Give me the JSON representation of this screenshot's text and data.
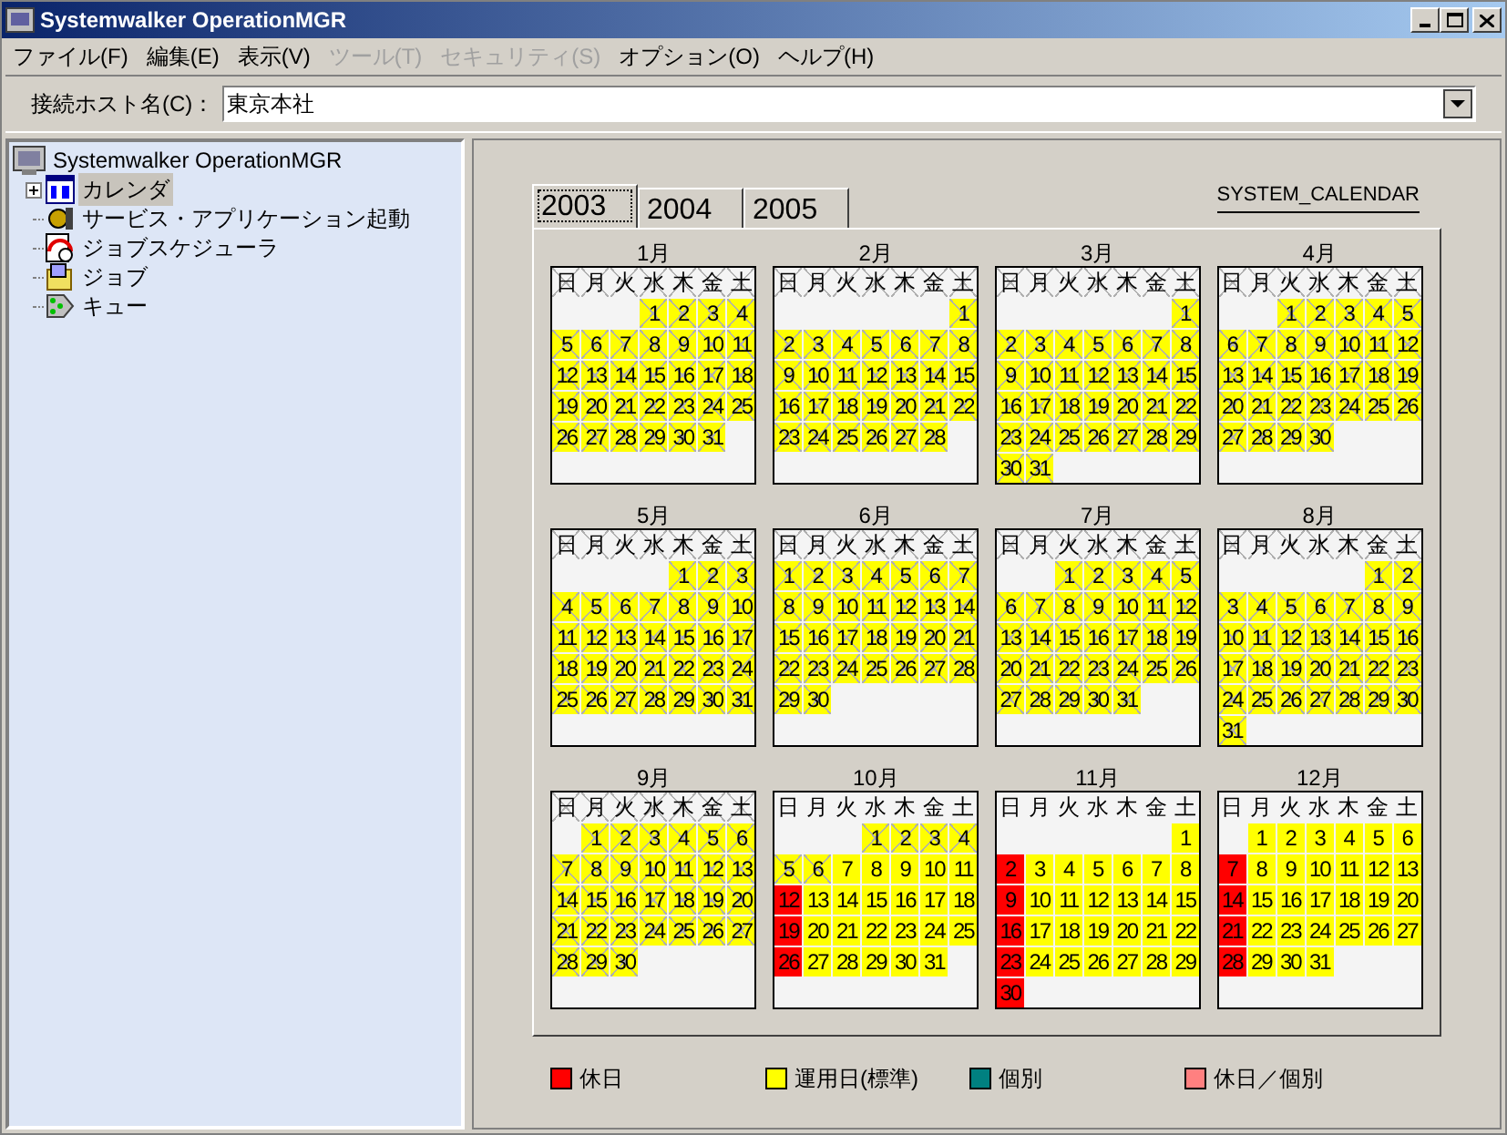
{
  "window": {
    "title": "Systemwalker OperationMGR"
  },
  "menu": [
    {
      "label": "ファイル(F)",
      "disabled": false
    },
    {
      "label": "編集(E)",
      "disabled": false
    },
    {
      "label": "表示(V)",
      "disabled": false
    },
    {
      "label": "ツール(T)",
      "disabled": true
    },
    {
      "label": "セキュリティ(S)",
      "disabled": true
    },
    {
      "label": "オプション(O)",
      "disabled": false
    },
    {
      "label": "ヘルプ(H)",
      "disabled": false
    }
  ],
  "host": {
    "label": "接続ホスト名(C)：",
    "value": "東京本社"
  },
  "tree": {
    "root": "Systemwalker OperationMGR",
    "children": [
      {
        "label": "カレンダ",
        "kind": "calendar",
        "selected": true,
        "expanded": false
      },
      {
        "label": "サービス・アプリケーション起動",
        "kind": "service",
        "selected": false
      },
      {
        "label": "ジョブスケジューラ",
        "kind": "scheduler",
        "selected": false
      },
      {
        "label": "ジョブ",
        "kind": "job",
        "selected": false
      },
      {
        "label": "キュー",
        "kind": "queue",
        "selected": false
      }
    ]
  },
  "tabs": [
    {
      "label": "2003",
      "selected": true
    },
    {
      "label": "2004",
      "selected": false
    },
    {
      "label": "2005",
      "selected": false
    }
  ],
  "calendar_name": "SYSTEM_CALENDAR",
  "months": [
    {
      "label": "1月",
      "weekdays": [
        "日",
        "月",
        "火",
        "水",
        "木",
        "金",
        "土"
      ],
      "weekdays_past": true,
      "days": [
        {
          "kind": "blank"
        },
        {
          "kind": "blank"
        },
        {
          "kind": "blank"
        },
        {
          "day": "1",
          "kind": "work",
          "past": true
        },
        {
          "day": "2",
          "kind": "work",
          "past": true
        },
        {
          "day": "3",
          "kind": "work",
          "past": true
        },
        {
          "day": "4",
          "kind": "work",
          "past": true
        },
        {
          "day": "5",
          "kind": "work",
          "past": true
        },
        {
          "day": "6",
          "kind": "work",
          "past": true
        },
        {
          "day": "7",
          "kind": "work",
          "past": true
        },
        {
          "day": "8",
          "kind": "work",
          "past": true
        },
        {
          "day": "9",
          "kind": "work",
          "past": true
        },
        {
          "day": "10",
          "kind": "work",
          "past": true
        },
        {
          "day": "11",
          "kind": "work",
          "past": true
        },
        {
          "day": "12",
          "kind": "work",
          "past": true
        },
        {
          "day": "13",
          "kind": "work",
          "past": true
        },
        {
          "day": "14",
          "kind": "work",
          "past": true
        },
        {
          "day": "15",
          "kind": "work",
          "past": true
        },
        {
          "day": "16",
          "kind": "work",
          "past": true
        },
        {
          "day": "17",
          "kind": "work",
          "past": true
        },
        {
          "day": "18",
          "kind": "work",
          "past": true
        },
        {
          "day": "19",
          "kind": "work",
          "past": true
        },
        {
          "day": "20",
          "kind": "work",
          "past": true
        },
        {
          "day": "21",
          "kind": "work",
          "past": true
        },
        {
          "day": "22",
          "kind": "work",
          "past": true
        },
        {
          "day": "23",
          "kind": "work",
          "past": true
        },
        {
          "day": "24",
          "kind": "work",
          "past": true
        },
        {
          "day": "25",
          "kind": "work",
          "past": true
        },
        {
          "day": "26",
          "kind": "work",
          "past": true
        },
        {
          "day": "27",
          "kind": "work",
          "past": true
        },
        {
          "day": "28",
          "kind": "work",
          "past": true
        },
        {
          "day": "29",
          "kind": "work",
          "past": true
        },
        {
          "day": "30",
          "kind": "work",
          "past": true
        },
        {
          "day": "31",
          "kind": "work",
          "past": true
        }
      ]
    },
    {
      "label": "2月",
      "weekdays": [
        "日",
        "月",
        "火",
        "水",
        "木",
        "金",
        "土"
      ],
      "weekdays_past": true,
      "days": [
        {
          "kind": "blank"
        },
        {
          "kind": "blank"
        },
        {
          "kind": "blank"
        },
        {
          "kind": "blank"
        },
        {
          "kind": "blank"
        },
        {
          "kind": "blank"
        },
        {
          "day": "1",
          "kind": "work",
          "past": true
        },
        {
          "day": "2",
          "kind": "work",
          "past": true
        },
        {
          "day": "3",
          "kind": "work",
          "past": true
        },
        {
          "day": "4",
          "kind": "work",
          "past": true
        },
        {
          "day": "5",
          "kind": "work",
          "past": true
        },
        {
          "day": "6",
          "kind": "work",
          "past": true
        },
        {
          "day": "7",
          "kind": "work",
          "past": true
        },
        {
          "day": "8",
          "kind": "work",
          "past": true
        },
        {
          "day": "9",
          "kind": "work",
          "past": true
        },
        {
          "day": "10",
          "kind": "work",
          "past": true
        },
        {
          "day": "11",
          "kind": "work",
          "past": true
        },
        {
          "day": "12",
          "kind": "work",
          "past": true
        },
        {
          "day": "13",
          "kind": "work",
          "past": true
        },
        {
          "day": "14",
          "kind": "work",
          "past": true
        },
        {
          "day": "15",
          "kind": "work",
          "past": true
        },
        {
          "day": "16",
          "kind": "work",
          "past": true
        },
        {
          "day": "17",
          "kind": "work",
          "past": true
        },
        {
          "day": "18",
          "kind": "work",
          "past": true
        },
        {
          "day": "19",
          "kind": "work",
          "past": true
        },
        {
          "day": "20",
          "kind": "work",
          "past": true
        },
        {
          "day": "21",
          "kind": "work",
          "past": true
        },
        {
          "day": "22",
          "kind": "work",
          "past": true
        },
        {
          "day": "23",
          "kind": "work",
          "past": true
        },
        {
          "day": "24",
          "kind": "work",
          "past": true
        },
        {
          "day": "25",
          "kind": "work",
          "past": true
        },
        {
          "day": "26",
          "kind": "work",
          "past": true
        },
        {
          "day": "27",
          "kind": "work",
          "past": true
        },
        {
          "day": "28",
          "kind": "work",
          "past": true
        }
      ]
    },
    {
      "label": "3月",
      "weekdays": [
        "日",
        "月",
        "火",
        "水",
        "木",
        "金",
        "土"
      ],
      "weekdays_past": true,
      "days": [
        {
          "kind": "blank"
        },
        {
          "kind": "blank"
        },
        {
          "kind": "blank"
        },
        {
          "kind": "blank"
        },
        {
          "kind": "blank"
        },
        {
          "kind": "blank"
        },
        {
          "day": "1",
          "kind": "work",
          "past": true
        },
        {
          "day": "2",
          "kind": "work",
          "past": true
        },
        {
          "day": "3",
          "kind": "work",
          "past": true
        },
        {
          "day": "4",
          "kind": "work",
          "past": true
        },
        {
          "day": "5",
          "kind": "work",
          "past": true
        },
        {
          "day": "6",
          "kind": "work",
          "past": true
        },
        {
          "day": "7",
          "kind": "work",
          "past": true
        },
        {
          "day": "8",
          "kind": "work",
          "past": true
        },
        {
          "day": "9",
          "kind": "work",
          "past": true
        },
        {
          "day": "10",
          "kind": "work",
          "past": true
        },
        {
          "day": "11",
          "kind": "work",
          "past": true
        },
        {
          "day": "12",
          "kind": "work",
          "past": true
        },
        {
          "day": "13",
          "kind": "work",
          "past": true
        },
        {
          "day": "14",
          "kind": "work",
          "past": true
        },
        {
          "day": "15",
          "kind": "work",
          "past": true
        },
        {
          "day": "16",
          "kind": "work",
          "past": true
        },
        {
          "day": "17",
          "kind": "work",
          "past": true
        },
        {
          "day": "18",
          "kind": "work",
          "past": true
        },
        {
          "day": "19",
          "kind": "work",
          "past": true
        },
        {
          "day": "20",
          "kind": "work",
          "past": true
        },
        {
          "day": "21",
          "kind": "work",
          "past": true
        },
        {
          "day": "22",
          "kind": "work",
          "past": true
        },
        {
          "day": "23",
          "kind": "work",
          "past": true
        },
        {
          "day": "24",
          "kind": "work",
          "past": true
        },
        {
          "day": "25",
          "kind": "work",
          "past": true
        },
        {
          "day": "26",
          "kind": "work",
          "past": true
        },
        {
          "day": "27",
          "kind": "work",
          "past": true
        },
        {
          "day": "28",
          "kind": "work",
          "past": true
        },
        {
          "day": "29",
          "kind": "work",
          "past": true
        },
        {
          "day": "30",
          "kind": "work",
          "past": true
        },
        {
          "day": "31",
          "kind": "work",
          "past": true
        }
      ]
    },
    {
      "label": "4月",
      "weekdays": [
        "日",
        "月",
        "火",
        "水",
        "木",
        "金",
        "土"
      ],
      "weekdays_past": true,
      "days": [
        {
          "kind": "blank"
        },
        {
          "kind": "blank"
        },
        {
          "day": "1",
          "kind": "work",
          "past": true
        },
        {
          "day": "2",
          "kind": "work",
          "past": true
        },
        {
          "day": "3",
          "kind": "work",
          "past": true
        },
        {
          "day": "4",
          "kind": "work",
          "past": true
        },
        {
          "day": "5",
          "kind": "work",
          "past": true
        },
        {
          "day": "6",
          "kind": "work",
          "past": true
        },
        {
          "day": "7",
          "kind": "work",
          "past": true
        },
        {
          "day": "8",
          "kind": "work",
          "past": true
        },
        {
          "day": "9",
          "kind": "work",
          "past": true
        },
        {
          "day": "10",
          "kind": "work",
          "past": true
        },
        {
          "day": "11",
          "kind": "work",
          "past": true
        },
        {
          "day": "12",
          "kind": "work",
          "past": true
        },
        {
          "day": "13",
          "kind": "work",
          "past": true
        },
        {
          "day": "14",
          "kind": "work",
          "past": true
        },
        {
          "day": "15",
          "kind": "work",
          "past": true
        },
        {
          "day": "16",
          "kind": "work",
          "past": true
        },
        {
          "day": "17",
          "kind": "work",
          "past": true
        },
        {
          "day": "18",
          "kind": "work",
          "past": true
        },
        {
          "day": "19",
          "kind": "work",
          "past": true
        },
        {
          "day": "20",
          "kind": "work",
          "past": true
        },
        {
          "day": "21",
          "kind": "work",
          "past": true
        },
        {
          "day": "22",
          "kind": "work",
          "past": true
        },
        {
          "day": "23",
          "kind": "work",
          "past": true
        },
        {
          "day": "24",
          "kind": "work",
          "past": true
        },
        {
          "day": "25",
          "kind": "work",
          "past": true
        },
        {
          "day": "26",
          "kind": "work",
          "past": true
        },
        {
          "day": "27",
          "kind": "work",
          "past": true
        },
        {
          "day": "28",
          "kind": "work",
          "past": true
        },
        {
          "day": "29",
          "kind": "work",
          "past": true
        },
        {
          "day": "30",
          "kind": "work",
          "past": true
        }
      ]
    },
    {
      "label": "5月",
      "weekdays": [
        "日",
        "月",
        "火",
        "水",
        "木",
        "金",
        "土"
      ],
      "weekdays_past": true,
      "days": [
        {
          "kind": "blank"
        },
        {
          "kind": "blank"
        },
        {
          "kind": "blank"
        },
        {
          "kind": "blank"
        },
        {
          "day": "1",
          "kind": "work",
          "past": true
        },
        {
          "day": "2",
          "kind": "work",
          "past": true
        },
        {
          "day": "3",
          "kind": "work",
          "past": true
        },
        {
          "day": "4",
          "kind": "work",
          "past": true
        },
        {
          "day": "5",
          "kind": "work",
          "past": true
        },
        {
          "day": "6",
          "kind": "work",
          "past": true
        },
        {
          "day": "7",
          "kind": "work",
          "past": true
        },
        {
          "day": "8",
          "kind": "work",
          "past": true
        },
        {
          "day": "9",
          "kind": "work",
          "past": true
        },
        {
          "day": "10",
          "kind": "work",
          "past": true
        },
        {
          "day": "11",
          "kind": "work",
          "past": true
        },
        {
          "day": "12",
          "kind": "work",
          "past": true
        },
        {
          "day": "13",
          "kind": "work",
          "past": true
        },
        {
          "day": "14",
          "kind": "work",
          "past": true
        },
        {
          "day": "15",
          "kind": "work",
          "past": true
        },
        {
          "day": "16",
          "kind": "work",
          "past": true
        },
        {
          "day": "17",
          "kind": "work",
          "past": true
        },
        {
          "day": "18",
          "kind": "work",
          "past": true
        },
        {
          "day": "19",
          "kind": "work",
          "past": true
        },
        {
          "day": "20",
          "kind": "work",
          "past": true
        },
        {
          "day": "21",
          "kind": "work",
          "past": true
        },
        {
          "day": "22",
          "kind": "work",
          "past": true
        },
        {
          "day": "23",
          "kind": "work",
          "past": true
        },
        {
          "day": "24",
          "kind": "work",
          "past": true
        },
        {
          "day": "25",
          "kind": "work",
          "past": true
        },
        {
          "day": "26",
          "kind": "work",
          "past": true
        },
        {
          "day": "27",
          "kind": "work",
          "past": true
        },
        {
          "day": "28",
          "kind": "work",
          "past": true
        },
        {
          "day": "29",
          "kind": "work",
          "past": true
        },
        {
          "day": "30",
          "kind": "work",
          "past": true
        },
        {
          "day": "31",
          "kind": "work",
          "past": true
        }
      ]
    },
    {
      "label": "6月",
      "weekdays": [
        "日",
        "月",
        "火",
        "水",
        "木",
        "金",
        "土"
      ],
      "weekdays_past": true,
      "days": [
        {
          "day": "1",
          "kind": "work",
          "past": true
        },
        {
          "day": "2",
          "kind": "work",
          "past": true
        },
        {
          "day": "3",
          "kind": "work",
          "past": true
        },
        {
          "day": "4",
          "kind": "work",
          "past": true
        },
        {
          "day": "5",
          "kind": "work",
          "past": true
        },
        {
          "day": "6",
          "kind": "work",
          "past": true
        },
        {
          "day": "7",
          "kind": "work",
          "past": true
        },
        {
          "day": "8",
          "kind": "work",
          "past": true
        },
        {
          "day": "9",
          "kind": "work",
          "past": true
        },
        {
          "day": "10",
          "kind": "work",
          "past": true
        },
        {
          "day": "11",
          "kind": "work",
          "past": true
        },
        {
          "day": "12",
          "kind": "work",
          "past": true
        },
        {
          "day": "13",
          "kind": "work",
          "past": true
        },
        {
          "day": "14",
          "kind": "work",
          "past": true
        },
        {
          "day": "15",
          "kind": "work",
          "past": true
        },
        {
          "day": "16",
          "kind": "work",
          "past": true
        },
        {
          "day": "17",
          "kind": "work",
          "past": true
        },
        {
          "day": "18",
          "kind": "work",
          "past": true
        },
        {
          "day": "19",
          "kind": "work",
          "past": true
        },
        {
          "day": "20",
          "kind": "work",
          "past": true
        },
        {
          "day": "21",
          "kind": "work",
          "past": true
        },
        {
          "day": "22",
          "kind": "work",
          "past": true
        },
        {
          "day": "23",
          "kind": "work",
          "past": true
        },
        {
          "day": "24",
          "kind": "work",
          "past": true
        },
        {
          "day": "25",
          "kind": "work",
          "past": true
        },
        {
          "day": "26",
          "kind": "work",
          "past": true
        },
        {
          "day": "27",
          "kind": "work",
          "past": true
        },
        {
          "day": "28",
          "kind": "work",
          "past": true
        },
        {
          "day": "29",
          "kind": "work",
          "past": true
        },
        {
          "day": "30",
          "kind": "work",
          "past": true
        }
      ]
    },
    {
      "label": "7月",
      "weekdays": [
        "日",
        "月",
        "火",
        "水",
        "木",
        "金",
        "土"
      ],
      "weekdays_past": true,
      "days": [
        {
          "kind": "blank"
        },
        {
          "kind": "blank"
        },
        {
          "day": "1",
          "kind": "work",
          "past": true
        },
        {
          "day": "2",
          "kind": "work",
          "past": true
        },
        {
          "day": "3",
          "kind": "work",
          "past": true
        },
        {
          "day": "4",
          "kind": "work",
          "past": true
        },
        {
          "day": "5",
          "kind": "work",
          "past": true
        },
        {
          "day": "6",
          "kind": "work",
          "past": true
        },
        {
          "day": "7",
          "kind": "work",
          "past": true
        },
        {
          "day": "8",
          "kind": "work",
          "past": true
        },
        {
          "day": "9",
          "kind": "work",
          "past": true
        },
        {
          "day": "10",
          "kind": "work",
          "past": true
        },
        {
          "day": "11",
          "kind": "work",
          "past": true
        },
        {
          "day": "12",
          "kind": "work",
          "past": true
        },
        {
          "day": "13",
          "kind": "work",
          "past": true
        },
        {
          "day": "14",
          "kind": "work",
          "past": true
        },
        {
          "day": "15",
          "kind": "work",
          "past": true
        },
        {
          "day": "16",
          "kind": "work",
          "past": true
        },
        {
          "day": "17",
          "kind": "work",
          "past": true
        },
        {
          "day": "18",
          "kind": "work",
          "past": true
        },
        {
          "day": "19",
          "kind": "work",
          "past": true
        },
        {
          "day": "20",
          "kind": "work",
          "past": true
        },
        {
          "day": "21",
          "kind": "work",
          "past": true
        },
        {
          "day": "22",
          "kind": "work",
          "past": true
        },
        {
          "day": "23",
          "kind": "work",
          "past": true
        },
        {
          "day": "24",
          "kind": "work",
          "past": true
        },
        {
          "day": "25",
          "kind": "work",
          "past": true
        },
        {
          "day": "26",
          "kind": "work",
          "past": true
        },
        {
          "day": "27",
          "kind": "work",
          "past": true
        },
        {
          "day": "28",
          "kind": "work",
          "past": true
        },
        {
          "day": "29",
          "kind": "work",
          "past": true
        },
        {
          "day": "30",
          "kind": "work",
          "past": true
        },
        {
          "day": "31",
          "kind": "work",
          "past": true
        }
      ]
    },
    {
      "label": "8月",
      "weekdays": [
        "日",
        "月",
        "火",
        "水",
        "木",
        "金",
        "土"
      ],
      "weekdays_past": true,
      "days": [
        {
          "kind": "blank"
        },
        {
          "kind": "blank"
        },
        {
          "kind": "blank"
        },
        {
          "kind": "blank"
        },
        {
          "kind": "blank"
        },
        {
          "day": "1",
          "kind": "work",
          "past": true
        },
        {
          "day": "2",
          "kind": "work",
          "past": true
        },
        {
          "day": "3",
          "kind": "work",
          "past": true
        },
        {
          "day": "4",
          "kind": "work",
          "past": true
        },
        {
          "day": "5",
          "kind": "work",
          "past": true
        },
        {
          "day": "6",
          "kind": "work",
          "past": true
        },
        {
          "day": "7",
          "kind": "work",
          "past": true
        },
        {
          "day": "8",
          "kind": "work",
          "past": true
        },
        {
          "day": "9",
          "kind": "work",
          "past": true
        },
        {
          "day": "10",
          "kind": "work",
          "past": true
        },
        {
          "day": "11",
          "kind": "work",
          "past": true
        },
        {
          "day": "12",
          "kind": "work",
          "past": true
        },
        {
          "day": "13",
          "kind": "work",
          "past": true
        },
        {
          "day": "14",
          "kind": "work",
          "past": true
        },
        {
          "day": "15",
          "kind": "work",
          "past": true
        },
        {
          "day": "16",
          "kind": "work",
          "past": true
        },
        {
          "day": "17",
          "kind": "work",
          "past": true
        },
        {
          "day": "18",
          "kind": "work",
          "past": true
        },
        {
          "day": "19",
          "kind": "work",
          "past": true
        },
        {
          "day": "20",
          "kind": "work",
          "past": true
        },
        {
          "day": "21",
          "kind": "work",
          "past": true
        },
        {
          "day": "22",
          "kind": "work",
          "past": true
        },
        {
          "day": "23",
          "kind": "work",
          "past": true
        },
        {
          "day": "24",
          "kind": "work",
          "past": true
        },
        {
          "day": "25",
          "kind": "work",
          "past": true
        },
        {
          "day": "26",
          "kind": "work",
          "past": true
        },
        {
          "day": "27",
          "kind": "work",
          "past": true
        },
        {
          "day": "28",
          "kind": "work",
          "past": true
        },
        {
          "day": "29",
          "kind": "work",
          "past": true
        },
        {
          "day": "30",
          "kind": "work",
          "past": true
        },
        {
          "day": "31",
          "kind": "work",
          "past": true
        }
      ]
    },
    {
      "label": "9月",
      "weekdays": [
        "日",
        "月",
        "火",
        "水",
        "木",
        "金",
        "土"
      ],
      "weekdays_past": true,
      "days": [
        {
          "kind": "blank"
        },
        {
          "day": "1",
          "kind": "work",
          "past": true
        },
        {
          "day": "2",
          "kind": "work",
          "past": true
        },
        {
          "day": "3",
          "kind": "work",
          "past": true
        },
        {
          "day": "4",
          "kind": "work",
          "past": true
        },
        {
          "day": "5",
          "kind": "work",
          "past": true
        },
        {
          "day": "6",
          "kind": "work",
          "past": true
        },
        {
          "day": "7",
          "kind": "work",
          "past": true
        },
        {
          "day": "8",
          "kind": "work",
          "past": true
        },
        {
          "day": "9",
          "kind": "work",
          "past": true
        },
        {
          "day": "10",
          "kind": "work",
          "past": true
        },
        {
          "day": "11",
          "kind": "work",
          "past": true
        },
        {
          "day": "12",
          "kind": "work",
          "past": true
        },
        {
          "day": "13",
          "kind": "work",
          "past": true
        },
        {
          "day": "14",
          "kind": "work",
          "past": true
        },
        {
          "day": "15",
          "kind": "work",
          "past": true
        },
        {
          "day": "16",
          "kind": "work",
          "past": true
        },
        {
          "day": "17",
          "kind": "work",
          "past": true
        },
        {
          "day": "18",
          "kind": "work",
          "past": true
        },
        {
          "day": "19",
          "kind": "work",
          "past": true
        },
        {
          "day": "20",
          "kind": "work",
          "past": true
        },
        {
          "day": "21",
          "kind": "work",
          "past": true
        },
        {
          "day": "22",
          "kind": "work",
          "past": true
        },
        {
          "day": "23",
          "kind": "work",
          "past": true
        },
        {
          "day": "24",
          "kind": "work",
          "past": true
        },
        {
          "day": "25",
          "kind": "work",
          "past": true
        },
        {
          "day": "26",
          "kind": "work",
          "past": true
        },
        {
          "day": "27",
          "kind": "work",
          "past": true
        },
        {
          "day": "28",
          "kind": "work",
          "past": true
        },
        {
          "day": "29",
          "kind": "work",
          "past": true
        },
        {
          "day": "30",
          "kind": "work",
          "past": true
        }
      ]
    },
    {
      "label": "10月",
      "weekdays": [
        "日",
        "月",
        "火",
        "水",
        "木",
        "金",
        "土"
      ],
      "weekdays_past": false,
      "days": [
        {
          "kind": "blank"
        },
        {
          "kind": "blank"
        },
        {
          "kind": "blank"
        },
        {
          "day": "1",
          "kind": "work",
          "past": true
        },
        {
          "day": "2",
          "kind": "work",
          "past": true
        },
        {
          "day": "3",
          "kind": "work",
          "past": true
        },
        {
          "day": "4",
          "kind": "work",
          "past": true
        },
        {
          "day": "5",
          "kind": "work",
          "past": true
        },
        {
          "day": "6",
          "kind": "work",
          "past": true
        },
        {
          "day": "7",
          "kind": "work",
          "past": false
        },
        {
          "day": "8",
          "kind": "work",
          "past": false
        },
        {
          "day": "9",
          "kind": "work",
          "past": false
        },
        {
          "day": "10",
          "kind": "work",
          "past": false
        },
        {
          "day": "11",
          "kind": "work",
          "past": false
        },
        {
          "day": "12",
          "kind": "holiday",
          "past": false
        },
        {
          "day": "13",
          "kind": "work",
          "past": false
        },
        {
          "day": "14",
          "kind": "work",
          "past": false
        },
        {
          "day": "15",
          "kind": "work",
          "past": false
        },
        {
          "day": "16",
          "kind": "work",
          "past": false
        },
        {
          "day": "17",
          "kind": "work",
          "past": false
        },
        {
          "day": "18",
          "kind": "work",
          "past": false
        },
        {
          "day": "19",
          "kind": "holiday",
          "past": false
        },
        {
          "day": "20",
          "kind": "work",
          "past": false
        },
        {
          "day": "21",
          "kind": "work",
          "past": false
        },
        {
          "day": "22",
          "kind": "work",
          "past": false
        },
        {
          "day": "23",
          "kind": "work",
          "past": false
        },
        {
          "day": "24",
          "kind": "work",
          "past": false
        },
        {
          "day": "25",
          "kind": "work",
          "past": false
        },
        {
          "day": "26",
          "kind": "holiday",
          "past": false
        },
        {
          "day": "27",
          "kind": "work",
          "past": false
        },
        {
          "day": "28",
          "kind": "work",
          "past": false
        },
        {
          "day": "29",
          "kind": "work",
          "past": false
        },
        {
          "day": "30",
          "kind": "work",
          "past": false
        },
        {
          "day": "31",
          "kind": "work",
          "past": false
        }
      ]
    },
    {
      "label": "11月",
      "weekdays": [
        "日",
        "月",
        "火",
        "水",
        "木",
        "金",
        "土"
      ],
      "weekdays_past": false,
      "days": [
        {
          "kind": "blank"
        },
        {
          "kind": "blank"
        },
        {
          "kind": "blank"
        },
        {
          "kind": "blank"
        },
        {
          "kind": "blank"
        },
        {
          "kind": "blank"
        },
        {
          "day": "1",
          "kind": "work",
          "past": false
        },
        {
          "day": "2",
          "kind": "holiday",
          "past": false
        },
        {
          "day": "3",
          "kind": "work",
          "past": false
        },
        {
          "day": "4",
          "kind": "work",
          "past": false
        },
        {
          "day": "5",
          "kind": "work",
          "past": false
        },
        {
          "day": "6",
          "kind": "work",
          "past": false
        },
        {
          "day": "7",
          "kind": "work",
          "past": false
        },
        {
          "day": "8",
          "kind": "work",
          "past": false
        },
        {
          "day": "9",
          "kind": "holiday",
          "past": false
        },
        {
          "day": "10",
          "kind": "work",
          "past": false
        },
        {
          "day": "11",
          "kind": "work",
          "past": false
        },
        {
          "day": "12",
          "kind": "work",
          "past": false
        },
        {
          "day": "13",
          "kind": "work",
          "past": false
        },
        {
          "day": "14",
          "kind": "work",
          "past": false
        },
        {
          "day": "15",
          "kind": "work",
          "past": false
        },
        {
          "day": "16",
          "kind": "holiday",
          "past": false
        },
        {
          "day": "17",
          "kind": "work",
          "past": false
        },
        {
          "day": "18",
          "kind": "work",
          "past": false
        },
        {
          "day": "19",
          "kind": "work",
          "past": false
        },
        {
          "day": "20",
          "kind": "work",
          "past": false
        },
        {
          "day": "21",
          "kind": "work",
          "past": false
        },
        {
          "day": "22",
          "kind": "work",
          "past": false
        },
        {
          "day": "23",
          "kind": "holiday",
          "past": false
        },
        {
          "day": "24",
          "kind": "work",
          "past": false
        },
        {
          "day": "25",
          "kind": "work",
          "past": false
        },
        {
          "day": "26",
          "kind": "work",
          "past": false
        },
        {
          "day": "27",
          "kind": "work",
          "past": false
        },
        {
          "day": "28",
          "kind": "work",
          "past": false
        },
        {
          "day": "29",
          "kind": "work",
          "past": false
        },
        {
          "day": "30",
          "kind": "holiday",
          "past": false
        }
      ]
    },
    {
      "label": "12月",
      "weekdays": [
        "日",
        "月",
        "火",
        "水",
        "木",
        "金",
        "土"
      ],
      "weekdays_past": false,
      "days": [
        {
          "kind": "blank"
        },
        {
          "day": "1",
          "kind": "work",
          "past": false
        },
        {
          "day": "2",
          "kind": "work",
          "past": false
        },
        {
          "day": "3",
          "kind": "work",
          "past": false
        },
        {
          "day": "4",
          "kind": "work",
          "past": false
        },
        {
          "day": "5",
          "kind": "work",
          "past": false
        },
        {
          "day": "6",
          "kind": "work",
          "past": false
        },
        {
          "day": "7",
          "kind": "holiday",
          "past": false
        },
        {
          "day": "8",
          "kind": "work",
          "past": false
        },
        {
          "day": "9",
          "kind": "work",
          "past": false
        },
        {
          "day": "10",
          "kind": "work",
          "past": false
        },
        {
          "day": "11",
          "kind": "work",
          "past": false
        },
        {
          "day": "12",
          "kind": "work",
          "past": false
        },
        {
          "day": "13",
          "kind": "work",
          "past": false
        },
        {
          "day": "14",
          "kind": "holiday",
          "past": false
        },
        {
          "day": "15",
          "kind": "work",
          "past": false
        },
        {
          "day": "16",
          "kind": "work",
          "past": false
        },
        {
          "day": "17",
          "kind": "work",
          "past": false
        },
        {
          "day": "18",
          "kind": "work",
          "past": false
        },
        {
          "day": "19",
          "kind": "work",
          "past": false
        },
        {
          "day": "20",
          "kind": "work",
          "past": false
        },
        {
          "day": "21",
          "kind": "holiday",
          "past": false
        },
        {
          "day": "22",
          "kind": "work",
          "past": false
        },
        {
          "day": "23",
          "kind": "work",
          "past": false
        },
        {
          "day": "24",
          "kind": "work",
          "past": false
        },
        {
          "day": "25",
          "kind": "work",
          "past": false
        },
        {
          "day": "26",
          "kind": "work",
          "past": false
        },
        {
          "day": "27",
          "kind": "work",
          "past": false
        },
        {
          "day": "28",
          "kind": "holiday",
          "past": false
        },
        {
          "day": "29",
          "kind": "work",
          "past": false
        },
        {
          "day": "30",
          "kind": "work",
          "past": false
        },
        {
          "day": "31",
          "kind": "work",
          "past": false
        }
      ]
    }
  ],
  "legend": [
    {
      "label": "休日",
      "color": "#ff0000"
    },
    {
      "label": "運用日(標準)",
      "color": "#ffff00"
    },
    {
      "label": "個別",
      "color": "#008080"
    },
    {
      "label": "休日／個別",
      "color": "#ff8080"
    }
  ]
}
